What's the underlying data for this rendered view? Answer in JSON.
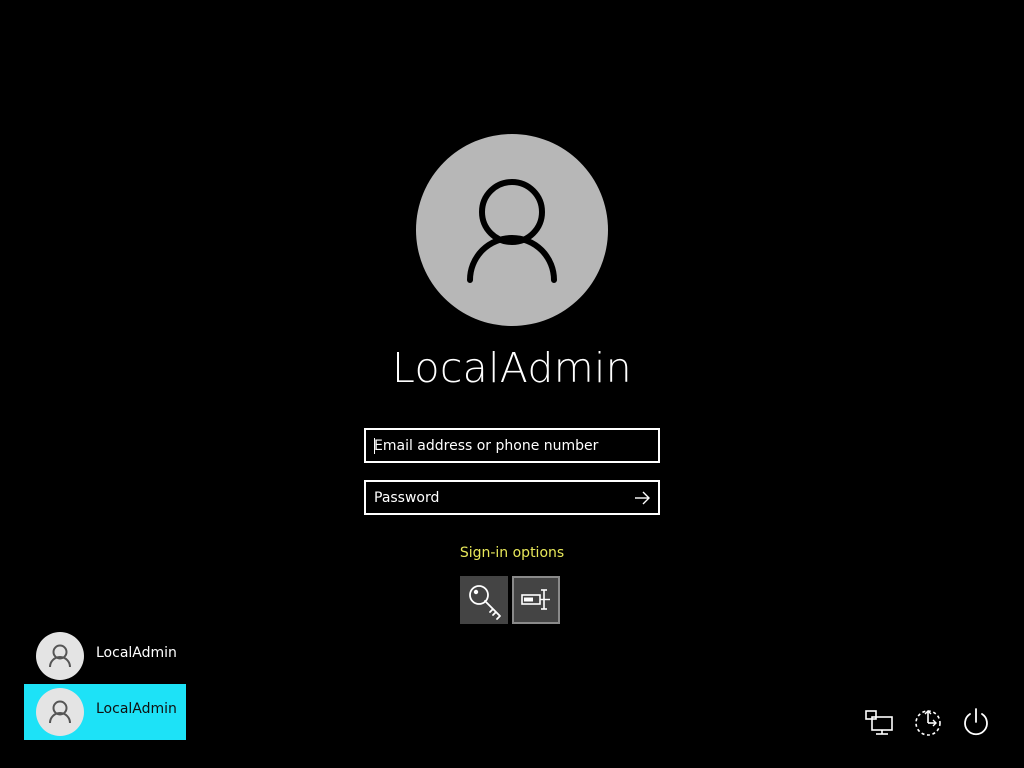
{
  "user": {
    "display_name": "LocalAdmin",
    "avatar_icon": "person-icon"
  },
  "login": {
    "email_placeholder": "Email address or phone number",
    "password_placeholder": "Password",
    "submit_icon": "arrow-right-icon"
  },
  "signin_options": {
    "label": "Sign-in options",
    "options": [
      {
        "icon": "key-icon",
        "selected": false
      },
      {
        "icon": "password-box-icon",
        "selected": true
      }
    ]
  },
  "user_list": [
    {
      "name": "LocalAdmin",
      "selected": false
    },
    {
      "name": "LocalAdmin",
      "selected": true
    }
  ],
  "tray": {
    "items": [
      {
        "icon": "network-icon"
      },
      {
        "icon": "ease-of-access-icon"
      },
      {
        "icon": "power-icon"
      }
    ]
  },
  "colors": {
    "background": "#000000",
    "avatar_bg": "#b7b7b7",
    "selected_user_bg": "#1de2f7",
    "link_color": "#e8e85a"
  }
}
